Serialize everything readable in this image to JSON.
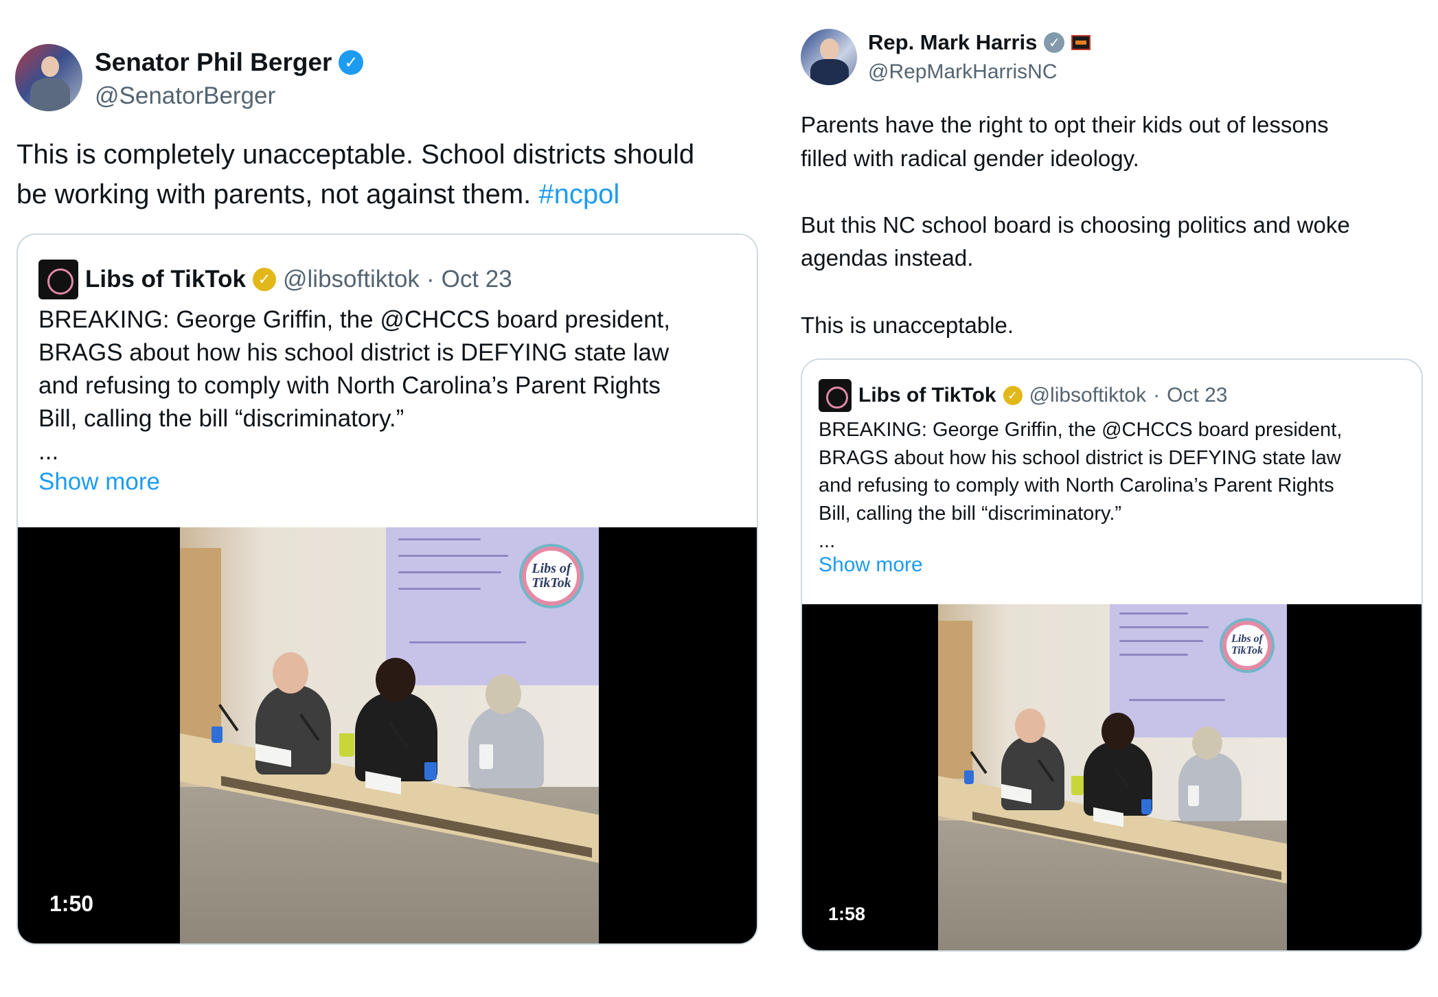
{
  "left_tweet": {
    "author": {
      "display_name": "Senator Phil Berger",
      "handle": "@SenatorBerger",
      "verified": "blue-check-icon"
    },
    "text_main": "This is completely unacceptable. School districts should\nbe working with parents, not against them. ",
    "hashtag": "#ncpol",
    "quote": {
      "name": "Libs of TikTok",
      "handle": "@libsoftiktok",
      "separator": "·",
      "date": "Oct 23",
      "verified": "gold-check-icon",
      "text": "BREAKING: George Griffin, the @CHCCS board president,\nBRAGS about how his school district is DEFYING state law\nand refusing to comply with North Carolina’s Parent Rights\nBill, calling the bill “discriminatory.”\n...",
      "show_more": "Show more",
      "video_duration": "1:50",
      "video_logo": "Libs of\nTikTok"
    }
  },
  "right_tweet": {
    "author": {
      "display_name": "Rep. Mark Harris",
      "handle": "@RepMarkHarrisNC",
      "verified": "gray-check-icon",
      "extra_badge": "flag-icon"
    },
    "text": "Parents have the right to opt their kids out of lessons\nfilled with radical gender ideology.\n\nBut this NC school board is choosing politics and woke\nagendas instead.\n\nThis is unacceptable.",
    "quote": {
      "name": "Libs of TikTok",
      "handle": "@libsoftiktok",
      "separator": "·",
      "date": "Oct 23",
      "verified": "gold-check-icon",
      "text": "BREAKING: George Griffin, the @CHCCS board president,\nBRAGS about how his school district is DEFYING state law\nand refusing to comply with North Carolina’s Parent Rights\nBill, calling the bill “discriminatory.”\n...",
      "show_more": "Show more",
      "video_duration": "1:58",
      "video_logo": "Libs of\nTikTok"
    }
  },
  "colors": {
    "link": "#1d9bf0",
    "muted": "#536471",
    "border": "#cfd9de",
    "text": "#0f1419"
  }
}
